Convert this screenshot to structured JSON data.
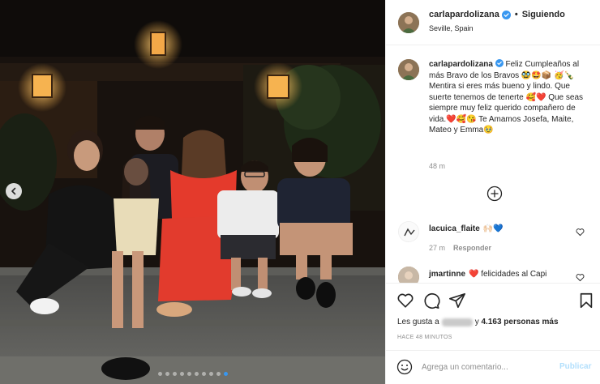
{
  "post": {
    "username": "carlapardolizana",
    "follow_label": "Siguiendo",
    "location": "Seville, Spain",
    "caption_user": "carlapardolizana",
    "caption_text": "Feliz Cumpleaños al más Bravo de los Bravos 🥸🤩📦 🥳🍾 Mentira si eres más bueno y lindo. Que suerte tenemos de tenerte 🥰❤️ Que seas siempre muy feliz querido compañero de vida.❤️🥰😘 Te Amamos Josefa, Maite, Mateo y Emma🥹",
    "caption_time": "48 m"
  },
  "comments": [
    {
      "user": "lacuica_flaite",
      "text": "🙌🏻💙",
      "time": "27 m",
      "reply_label": "Responder"
    },
    {
      "user": "jmartinne",
      "text": "❤️ felicidades al Capi"
    }
  ],
  "likes": {
    "prefix": "Les gusta a",
    "count_text": "4.163 personas más",
    "conjunction": "y"
  },
  "time_ago": "HACE 48 MINUTOS",
  "add_comment": {
    "placeholder": "Agrega un comentario...",
    "publish_label": "Publicar"
  },
  "carousel": {
    "dot_count": 10,
    "active_index": 9
  },
  "icons": [
    "verified-icon",
    "chevron-left-icon",
    "plus-circle-icon",
    "heart-icon",
    "comment-icon",
    "share-icon",
    "bookmark-icon",
    "emoji-icon"
  ],
  "colors": {
    "verified": "#3897f0",
    "heart": "#ed4956",
    "publish_disabled": "#b2dffc",
    "secondary_text": "#8e8e8e"
  }
}
